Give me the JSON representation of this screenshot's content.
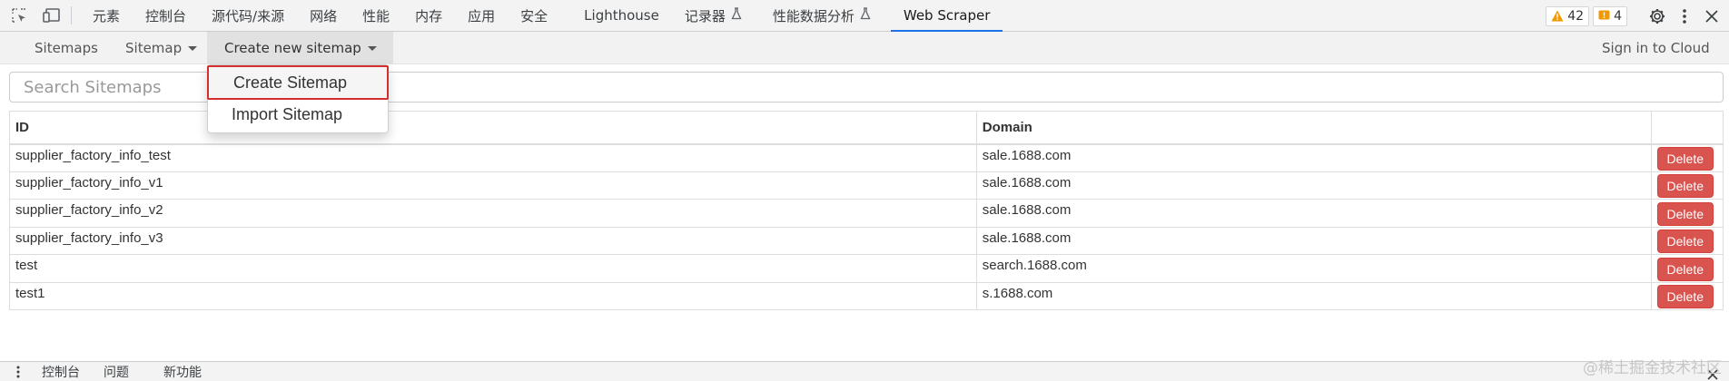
{
  "devtools": {
    "tabs": [
      {
        "label": "元素"
      },
      {
        "label": "控制台"
      },
      {
        "label": "源代码/来源"
      },
      {
        "label": "网络"
      },
      {
        "label": "性能"
      },
      {
        "label": "内存"
      },
      {
        "label": "应用"
      },
      {
        "label": "安全"
      },
      {
        "label": "Lighthouse"
      },
      {
        "label": "记录器"
      },
      {
        "label": "性能数据分析"
      },
      {
        "label": "Web Scraper"
      }
    ],
    "active_tab": "Web Scraper",
    "warnings_count": "42",
    "issues_count": "4",
    "accent_color": "#1a73e8"
  },
  "scraper_nav": {
    "sitemaps": "Sitemaps",
    "sitemap": "Sitemap",
    "create_new": "Create new sitemap",
    "sign_in": "Sign in to Cloud"
  },
  "dropdown": {
    "items": [
      "Create Sitemap",
      "Import Sitemap"
    ],
    "highlight_color": "#d32f2f"
  },
  "search": {
    "placeholder": "Search Sitemaps"
  },
  "table": {
    "headers": {
      "id": "ID",
      "domain": "Domain"
    },
    "rows": [
      {
        "id": "supplier_factory_info_test",
        "domain": "sale.1688.com",
        "action": "Delete"
      },
      {
        "id": "supplier_factory_info_v1",
        "domain": "sale.1688.com",
        "action": "Delete"
      },
      {
        "id": "supplier_factory_info_v2",
        "domain": "sale.1688.com",
        "action": "Delete"
      },
      {
        "id": "supplier_factory_info_v3",
        "domain": "sale.1688.com",
        "action": "Delete"
      },
      {
        "id": "test",
        "domain": "search.1688.com",
        "action": "Delete"
      },
      {
        "id": "test1",
        "domain": "s.1688.com",
        "action": "Delete"
      }
    ],
    "delete_color": "#d9534f"
  },
  "drawer": {
    "tabs": [
      "控制台",
      "问题",
      "新功能"
    ]
  },
  "watermark": "@稀土掘金技术社区"
}
